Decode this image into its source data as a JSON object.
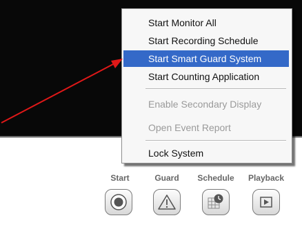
{
  "menu": {
    "items": [
      {
        "label": "Start Monitor All",
        "state": "normal"
      },
      {
        "label": "Start Recording Schedule",
        "state": "normal"
      },
      {
        "label": "Start Smart Guard System",
        "state": "highlighted"
      },
      {
        "label": "Start Counting Application",
        "state": "normal"
      },
      {
        "label": "Enable Secondary Display",
        "state": "disabled"
      },
      {
        "label": "Open Event Report",
        "state": "disabled"
      },
      {
        "label": "Lock System",
        "state": "normal"
      }
    ]
  },
  "controls": [
    {
      "label": "Start",
      "icon": "record-icon"
    },
    {
      "label": "Guard",
      "icon": "warning-triangle-icon"
    },
    {
      "label": "Schedule",
      "icon": "schedule-grid-icon"
    },
    {
      "label": "Playback",
      "icon": "play-icon"
    }
  ],
  "colors": {
    "highlight": "#3469c8",
    "annotation_arrow": "#e01818",
    "monitor_background": "#080808"
  }
}
